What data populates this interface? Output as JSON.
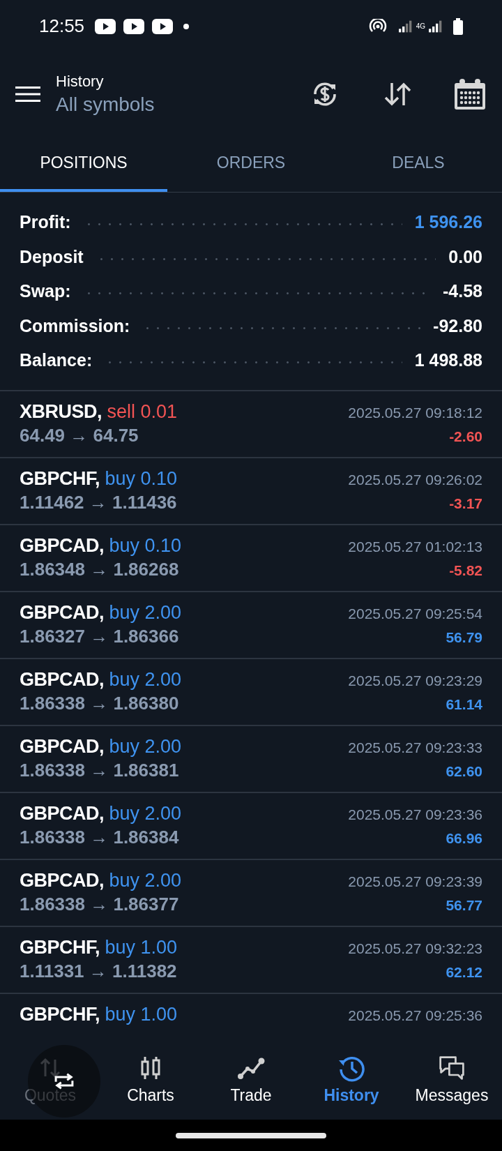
{
  "status_bar": {
    "time": "12:55",
    "network": "4G"
  },
  "header": {
    "title": "History",
    "subtitle": "All symbols"
  },
  "tabs": [
    {
      "label": "POSITIONS",
      "selected": true
    },
    {
      "label": "ORDERS",
      "selected": false
    },
    {
      "label": "DEALS",
      "selected": false
    }
  ],
  "summary": [
    {
      "label": "Profit:",
      "value": "1 596.26",
      "highlighted": true
    },
    {
      "label": "Deposit",
      "value": "0.00",
      "highlighted": false
    },
    {
      "label": "Swap:",
      "value": "-4.58",
      "highlighted": false
    },
    {
      "label": "Commission:",
      "value": "-92.80",
      "highlighted": false
    },
    {
      "label": "Balance:",
      "value": "1 498.88",
      "highlighted": false
    }
  ],
  "positions": [
    {
      "symbol": "XBRUSD,",
      "type": "sell",
      "volume": "0.01",
      "prices": "64.49 → 64.75",
      "time": "2025.05.27 09:18:12",
      "profit": "-2.60",
      "negative": true
    },
    {
      "symbol": "GBPCHF,",
      "type": "buy",
      "volume": "0.10",
      "prices": "1.11462 → 1.11436",
      "time": "2025.05.27 09:26:02",
      "profit": "-3.17",
      "negative": true
    },
    {
      "symbol": "GBPCAD,",
      "type": "buy",
      "volume": "0.10",
      "prices": "1.86348 → 1.86268",
      "time": "2025.05.27 01:02:13",
      "profit": "-5.82",
      "negative": true
    },
    {
      "symbol": "GBPCAD,",
      "type": "buy",
      "volume": "2.00",
      "prices": "1.86327 → 1.86366",
      "time": "2025.05.27 09:25:54",
      "profit": "56.79",
      "negative": false
    },
    {
      "symbol": "GBPCAD,",
      "type": "buy",
      "volume": "2.00",
      "prices": "1.86338 → 1.86380",
      "time": "2025.05.27 09:23:29",
      "profit": "61.14",
      "negative": false
    },
    {
      "symbol": "GBPCAD,",
      "type": "buy",
      "volume": "2.00",
      "prices": "1.86338 → 1.86381",
      "time": "2025.05.27 09:23:33",
      "profit": "62.60",
      "negative": false
    },
    {
      "symbol": "GBPCAD,",
      "type": "buy",
      "volume": "2.00",
      "prices": "1.86338 → 1.86384",
      "time": "2025.05.27 09:23:36",
      "profit": "66.96",
      "negative": false
    },
    {
      "symbol": "GBPCAD,",
      "type": "buy",
      "volume": "2.00",
      "prices": "1.86338 → 1.86377",
      "time": "2025.05.27 09:23:39",
      "profit": "56.77",
      "negative": false
    },
    {
      "symbol": "GBPCHF,",
      "type": "buy",
      "volume": "1.00",
      "prices": "1.11331 → 1.11382",
      "time": "2025.05.27 09:32:23",
      "profit": "62.12",
      "negative": false
    },
    {
      "symbol": "GBPCHF,",
      "type": "buy",
      "volume": "1.00",
      "time": "2025.05.27 09:25:36"
    }
  ],
  "bottom_nav": [
    {
      "kind": "quotes",
      "label": "Quotes",
      "selected": false
    },
    {
      "kind": "charts",
      "label": "Charts",
      "selected": false
    },
    {
      "kind": "trade",
      "label": "Trade",
      "selected": false
    },
    {
      "kind": "history",
      "label": "History",
      "selected": true
    },
    {
      "kind": "messages",
      "label": "Messages",
      "selected": false
    }
  ]
}
